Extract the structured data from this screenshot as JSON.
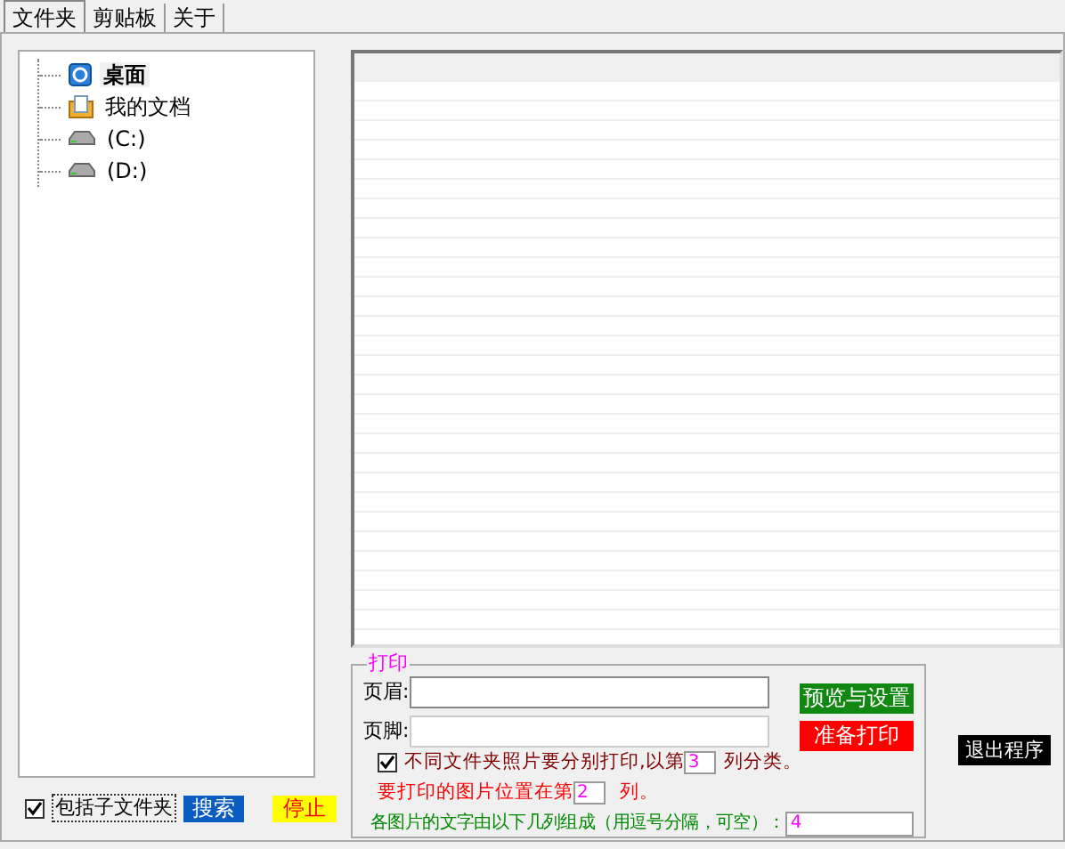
{
  "tabs": [
    {
      "label": "文件夹",
      "selected": true
    },
    {
      "label": "剪贴板",
      "selected": false
    },
    {
      "label": "关于",
      "selected": false
    }
  ],
  "tree": {
    "items": [
      {
        "label": "桌面",
        "kind": "desktop",
        "selected": true
      },
      {
        "label": "我的文档",
        "kind": "documents",
        "selected": false
      },
      {
        "label": "(C:)",
        "kind": "drive",
        "selected": false
      },
      {
        "label": "(D:)",
        "kind": "drive",
        "selected": false
      }
    ]
  },
  "print": {
    "title": "打印",
    "header_label": "页眉:",
    "footer_label": "页脚:",
    "preview_button": "预览与设置",
    "print_button": "准备打印",
    "separate": {
      "checked": true,
      "before": "不同文件夹照片要分别打印,以第",
      "value": "3",
      "after": "列分类。"
    },
    "position": {
      "before": "要打印的图片位置在第",
      "value": "2",
      "after": "列。"
    },
    "caption": {
      "label": "各图片的文字由以下几列组成（用逗号分隔，可空）：",
      "value": "4"
    }
  },
  "include_subfolders": {
    "label": "包括子文件夹",
    "checked": true
  },
  "search_button": "搜索",
  "stop_button": "停止",
  "exit_button": "退出程序"
}
